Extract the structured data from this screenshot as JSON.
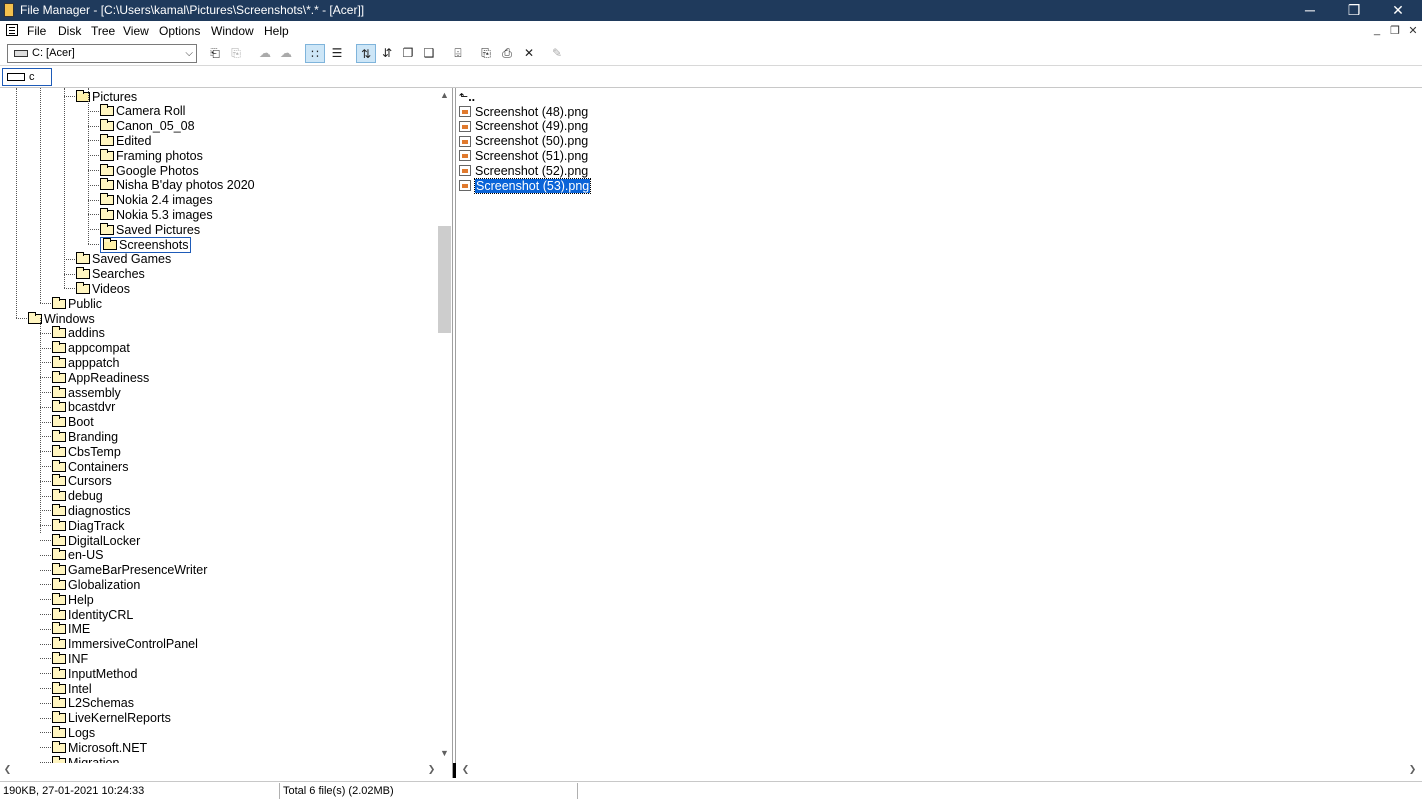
{
  "window": {
    "title": "File Manager - [C:\\Users\\kamal\\Pictures\\Screenshots\\*.* - [Acer]]",
    "minimize_glyph": "─",
    "maximize_glyph": "❒",
    "close_glyph": "✕"
  },
  "menu": {
    "items": [
      "File",
      "Disk",
      "Tree",
      "View",
      "Options",
      "Window",
      "Help"
    ],
    "mdi_minimize": "_",
    "mdi_restore": "❐",
    "mdi_close": "✕"
  },
  "toolbar": {
    "drive_select_value": "C: [Acer]",
    "caret": "⌵",
    "buttons": [
      {
        "icon": "connect-drive-icon",
        "glyph": "⎗"
      },
      {
        "icon": "disconnect-drive-icon",
        "glyph": "⎘"
      },
      {
        "icon": "share-icon",
        "glyph": "☁"
      },
      {
        "icon": "stop-sharing-icon",
        "glyph": "☁"
      },
      {
        "icon": "large-icons-view-icon",
        "glyph": "∷"
      },
      {
        "icon": "list-view-icon",
        "glyph": "☰"
      },
      {
        "icon": "sort-by-name-icon",
        "glyph": "⇅"
      },
      {
        "icon": "sort-by-type-icon",
        "glyph": "⇵"
      },
      {
        "icon": "sort-by-size-icon",
        "glyph": "❐"
      },
      {
        "icon": "sort-by-date-icon",
        "glyph": "❑"
      },
      {
        "icon": "new-window-icon",
        "glyph": "⌹"
      },
      {
        "icon": "copy-icon",
        "glyph": "⎘"
      },
      {
        "icon": "move-icon",
        "glyph": "⎙"
      },
      {
        "icon": "delete-icon",
        "glyph": "✕"
      },
      {
        "icon": "properties-icon",
        "glyph": "✎"
      }
    ]
  },
  "drive_bar": {
    "drive_label": "c"
  },
  "tree": {
    "items": [
      {
        "label": "Pictures",
        "depth": 2,
        "open": true
      },
      {
        "label": "Camera Roll",
        "depth": 3
      },
      {
        "label": "Canon_05_08",
        "depth": 3
      },
      {
        "label": "Edited",
        "depth": 3
      },
      {
        "label": "Framing photos",
        "depth": 3
      },
      {
        "label": "Google Photos",
        "depth": 3
      },
      {
        "label": "Nisha B'day photos 2020",
        "depth": 3
      },
      {
        "label": "Nokia 2.4 images",
        "depth": 3
      },
      {
        "label": "Nokia 5.3 images",
        "depth": 3
      },
      {
        "label": "Saved Pictures",
        "depth": 3
      },
      {
        "label": "Screenshots",
        "depth": 3,
        "open": true,
        "selected": true
      },
      {
        "label": "Saved Games",
        "depth": 2
      },
      {
        "label": "Searches",
        "depth": 2
      },
      {
        "label": "Videos",
        "depth": 2
      },
      {
        "label": "Public",
        "depth": 1
      },
      {
        "label": "Windows",
        "depth": 0
      },
      {
        "label": "addins",
        "depth": 1
      },
      {
        "label": "appcompat",
        "depth": 1
      },
      {
        "label": "apppatch",
        "depth": 1
      },
      {
        "label": "AppReadiness",
        "depth": 1
      },
      {
        "label": "assembly",
        "depth": 1
      },
      {
        "label": "bcastdvr",
        "depth": 1
      },
      {
        "label": "Boot",
        "depth": 1
      },
      {
        "label": "Branding",
        "depth": 1
      },
      {
        "label": "CbsTemp",
        "depth": 1
      },
      {
        "label": "Containers",
        "depth": 1
      },
      {
        "label": "Cursors",
        "depth": 1
      },
      {
        "label": "debug",
        "depth": 1
      },
      {
        "label": "diagnostics",
        "depth": 1
      },
      {
        "label": "DiagTrack",
        "depth": 1
      },
      {
        "label": "DigitalLocker",
        "depth": 1
      },
      {
        "label": "en-US",
        "depth": 1
      },
      {
        "label": "GameBarPresenceWriter",
        "depth": 1
      },
      {
        "label": "Globalization",
        "depth": 1
      },
      {
        "label": "Help",
        "depth": 1
      },
      {
        "label": "IdentityCRL",
        "depth": 1
      },
      {
        "label": "IME",
        "depth": 1
      },
      {
        "label": "ImmersiveControlPanel",
        "depth": 1
      },
      {
        "label": "INF",
        "depth": 1
      },
      {
        "label": "InputMethod",
        "depth": 1
      },
      {
        "label": "Intel",
        "depth": 1
      },
      {
        "label": "L2Schemas",
        "depth": 1
      },
      {
        "label": "LiveKernelReports",
        "depth": 1
      },
      {
        "label": "Logs",
        "depth": 1
      },
      {
        "label": "Microsoft.NET",
        "depth": 1
      },
      {
        "label": "Migration",
        "depth": 1
      }
    ]
  },
  "files": {
    "up_label": "..",
    "up_glyph": "⬑",
    "items": [
      {
        "name": "Screenshot (48).png"
      },
      {
        "name": "Screenshot (49).png"
      },
      {
        "name": "Screenshot (50).png"
      },
      {
        "name": "Screenshot (51).png"
      },
      {
        "name": "Screenshot (52).png"
      },
      {
        "name": "Screenshot (53).png",
        "selected": true
      }
    ]
  },
  "scroll": {
    "up": "▲",
    "down": "▼",
    "left": "❮",
    "right": "❯"
  },
  "status": {
    "selection_info": "190KB, 27-01-2021 10:24:33",
    "total_info": "Total 6 file(s) (2.02MB)"
  }
}
